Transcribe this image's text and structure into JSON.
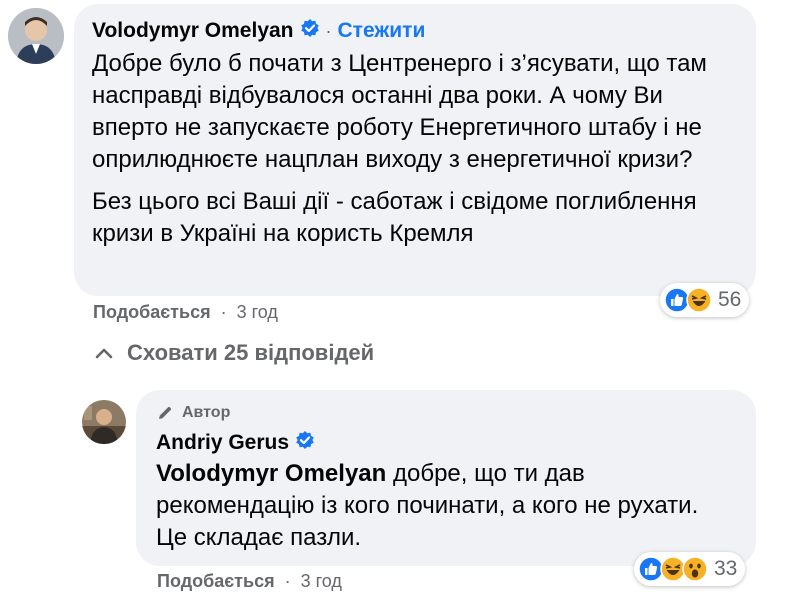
{
  "comment": {
    "author": "Volodymyr Omelyan",
    "follow_label": "Стежити",
    "separator": "·",
    "paragraph_1": "Добре було б почати з Центренерго і з’ясувати, що там насправді відбувалося останні два роки. А чому Ви вперто не запускаєте роботу Енергетичного штабу і не оприлюднюєте нацплан виходу з енергетичної кризи?",
    "paragraph_2": "Без цього всі Ваші дії - саботаж і свідоме поглиблення кризи в Україні на користь Кремля",
    "like_label": "Подобається",
    "time": "3 год",
    "reaction_count": "56",
    "reactions": [
      "like",
      "haha"
    ]
  },
  "replies_toggle": {
    "label": "Сховати 25 відповідей"
  },
  "reply": {
    "badge": "Автор",
    "author": "Andriy Gerus",
    "mention": "Volodymyr Omelyan",
    "text": " добре, що ти дав рекомендацію із кого починати, а кого не рухати. Це складає пазли.",
    "like_label": "Подобається",
    "time": "3 год",
    "reaction_count": "33",
    "reactions": [
      "like",
      "haha",
      "wow"
    ]
  },
  "colors": {
    "bubble": "#f0f2f5",
    "link_blue": "#1877f2",
    "secondary_text": "#65676b",
    "like_blue": "#1877f2",
    "emoji_yellow": "#f7b125"
  }
}
